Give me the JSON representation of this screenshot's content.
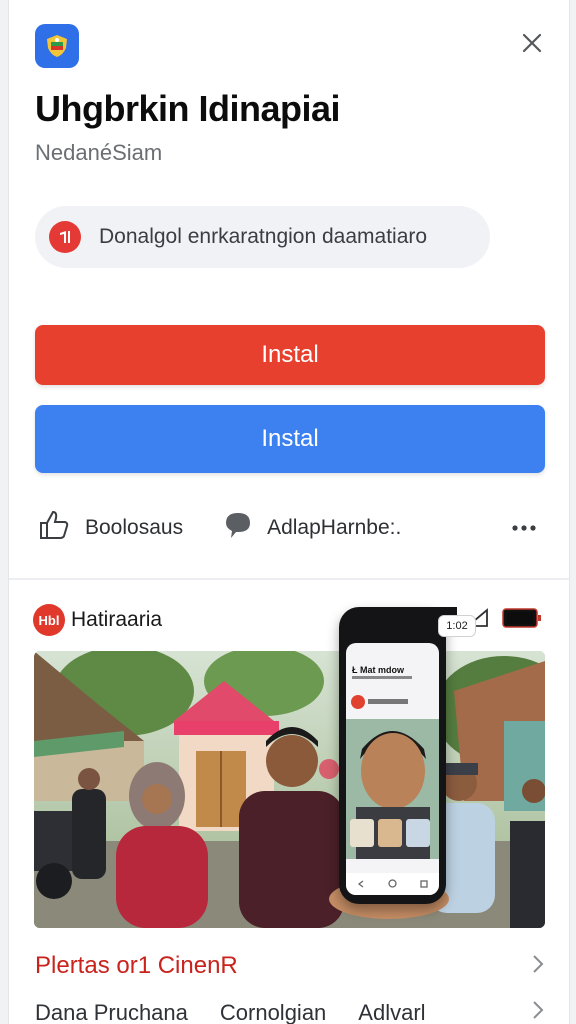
{
  "app": {
    "icon": "app-shield-icon",
    "title": "Uhgbrkin Idinapiai",
    "publisher": "NedanéSiam"
  },
  "notice": {
    "icon": "alert-badge-icon",
    "text": "Donalgol enrkaratngion daamatiaro"
  },
  "buttons": {
    "primary_label": "Instal",
    "secondary_label": "Instal"
  },
  "actions": {
    "like_label": "Boolosaus",
    "comment_label": "AdlapHarnbe:.",
    "more_icon": "more-dots-icon"
  },
  "post": {
    "avatar_text": "Hbl",
    "author": "Hatiraaria",
    "phone_badge": "1:02",
    "phone_title": "Ł Mat mdow",
    "caption": "Plertas or1 CinenR"
  },
  "bottom_row": {
    "item1": "Dana Pruchana",
    "item2": "Cornolgian",
    "item3": "Adlvarl"
  },
  "colors": {
    "red_button": "#e8402f",
    "blue_button": "#3d80f0",
    "caption": "#c8231c"
  }
}
